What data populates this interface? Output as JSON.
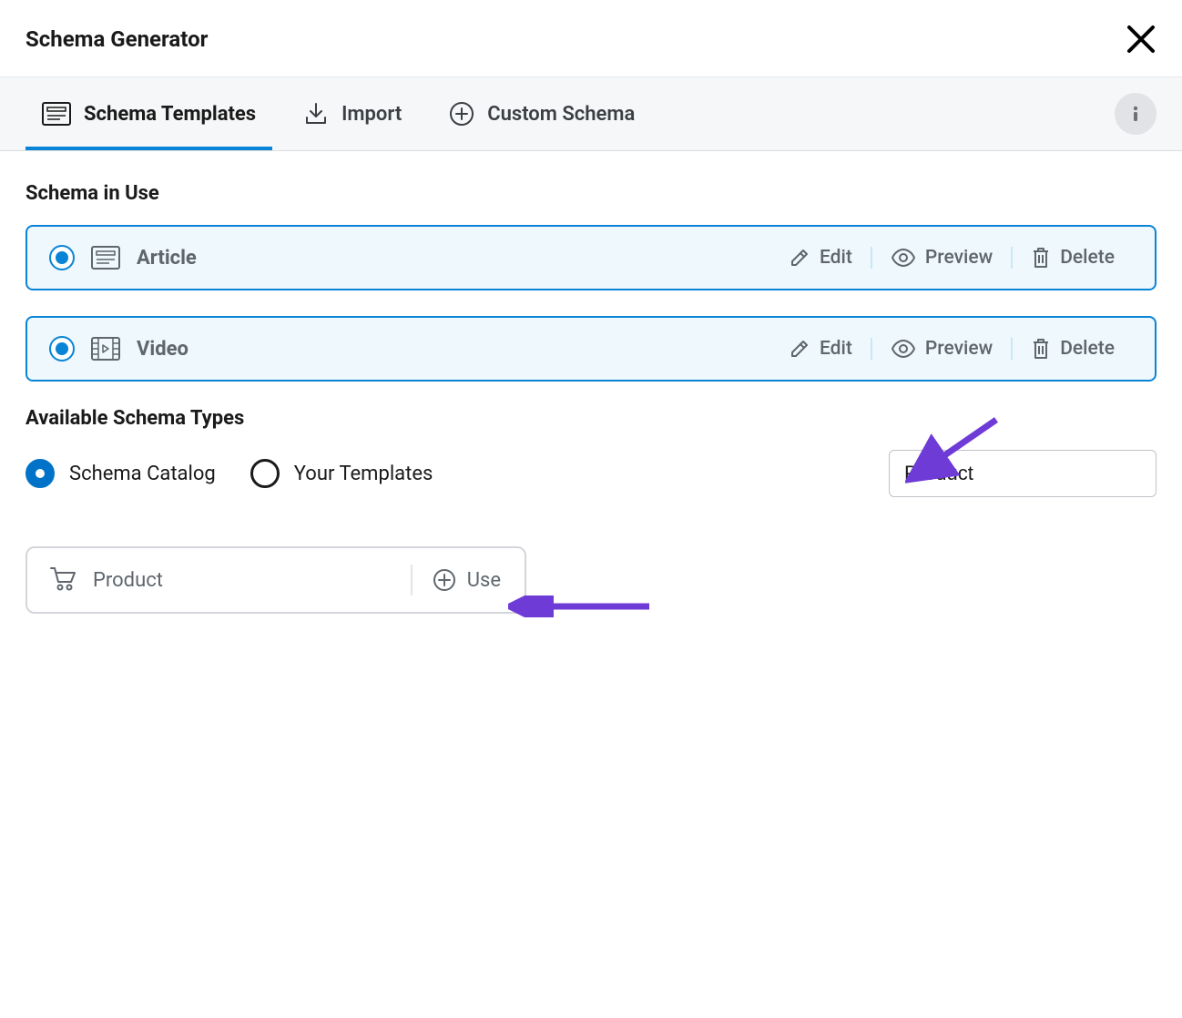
{
  "header": {
    "title": "Schema Generator"
  },
  "tabs": [
    {
      "label": "Schema Templates",
      "active": true
    },
    {
      "label": "Import",
      "active": false
    },
    {
      "label": "Custom Schema",
      "active": false
    }
  ],
  "section_in_use": {
    "title": "Schema in Use",
    "items": [
      {
        "name": "Article",
        "icon": "template-icon"
      },
      {
        "name": "Video",
        "icon": "video-icon"
      }
    ],
    "actions": {
      "edit": "Edit",
      "preview": "Preview",
      "delete": "Delete"
    }
  },
  "section_available": {
    "title": "Available Schema Types",
    "filters": [
      {
        "label": "Schema Catalog",
        "selected": true
      },
      {
        "label": "Your Templates",
        "selected": false
      }
    ],
    "search_value": "Product",
    "result": {
      "name": "Product",
      "use_label": "Use"
    }
  }
}
